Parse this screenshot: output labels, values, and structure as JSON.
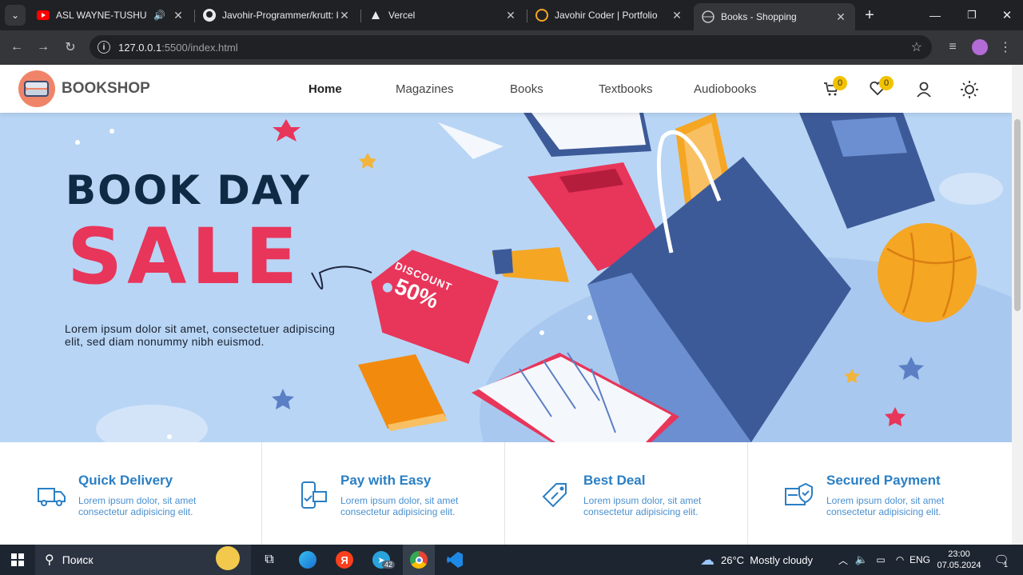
{
  "browser": {
    "tabs": [
      {
        "title": "ASL WAYNE-TUSHUNMI",
        "audio": true
      },
      {
        "title": "Javohir-Programmer/krutt: k"
      },
      {
        "title": "Vercel"
      },
      {
        "title": "Javohir Coder | Portfolio"
      },
      {
        "title": "Books - Shopping",
        "active": true
      }
    ],
    "new_tab": "+",
    "url_host": "127.0.0.1",
    "url_rest": ":5500/index.html"
  },
  "site": {
    "logo_text": "BOOKSHOP",
    "nav": [
      "Home",
      "Magazines",
      "Books",
      "Textbooks",
      "Audiobooks"
    ],
    "cart_count": "0",
    "wishlist_count": "0"
  },
  "hero": {
    "title_line1": "BOOK DAY",
    "title_line2": "SALE",
    "tag_line1": "DISCOUNT",
    "tag_line2": "50%",
    "description": "Lorem ipsum dolor sit amet, consectetuer adipiscing elit, sed diam nonummy nibh euismod."
  },
  "features": [
    {
      "title": "Quick Delivery",
      "desc": "Lorem ipsum dolor, sit amet consectetur adipisicing elit.",
      "icon": "truck-icon"
    },
    {
      "title": "Pay with Easy",
      "desc": "Lorem ipsum dolor, sit amet consectetur adipisicing elit.",
      "icon": "phone-card-icon"
    },
    {
      "title": "Best Deal",
      "desc": "Lorem ipsum dolor, sit amet consectetur adipisicing elit.",
      "icon": "tag-icon"
    },
    {
      "title": "Secured Payment",
      "desc": "Lorem ipsum dolor, sit amet consectetur adipisicing elit.",
      "icon": "shield-card-icon"
    }
  ],
  "taskbar": {
    "search_placeholder": "Поиск",
    "telegram_badge": "42",
    "weather": "26°C  Mostly cloudy",
    "lang": "ENG",
    "time": "23:00",
    "date": "07.05.2024",
    "notif_count": "1"
  },
  "colors": {
    "accent": "#2a7fc4",
    "sale": "#e8355a",
    "hero_bg": "#b8d5f5",
    "badge": "#f2c200"
  }
}
